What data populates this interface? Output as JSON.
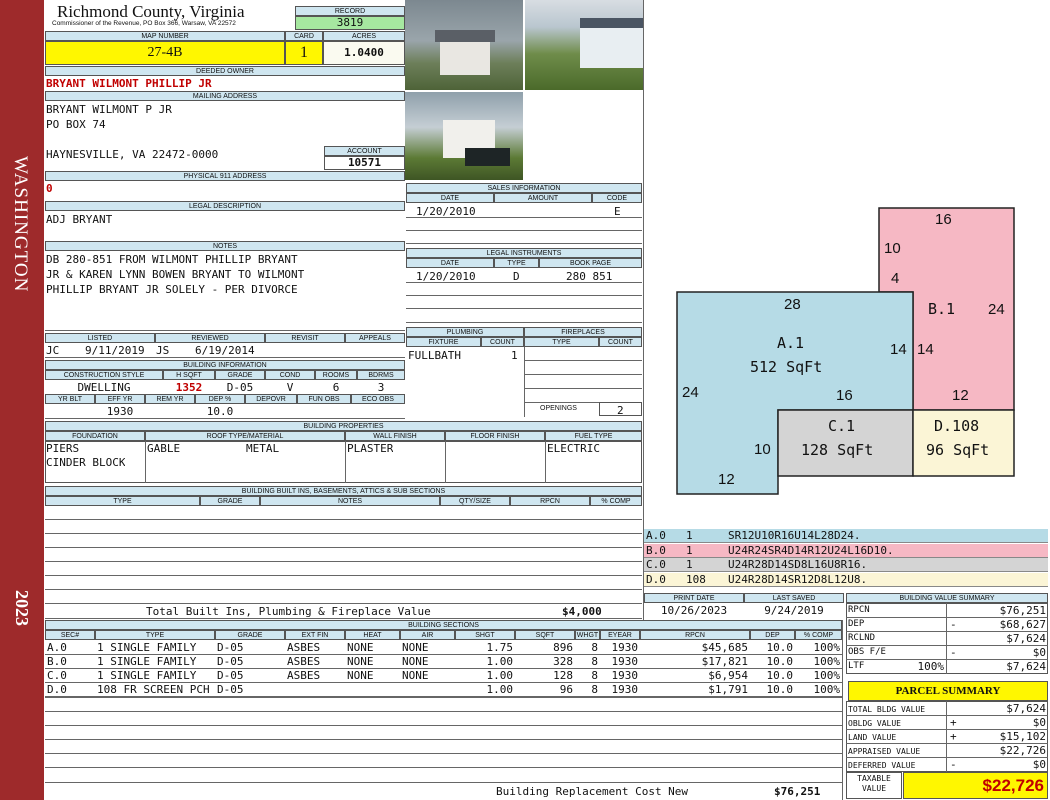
{
  "side": {
    "locality": "WASHINGTON",
    "year": "2023"
  },
  "header": {
    "county": "Richmond County, Virginia",
    "commissioner": "Commissioner of the Revenue, PO Box 366, Warsaw, VA 22572"
  },
  "record": {
    "label": "RECORD",
    "value": "3819"
  },
  "map": {
    "label": "MAP NUMBER",
    "value": "27-4B"
  },
  "card": {
    "label": "CARD",
    "value": "1"
  },
  "acres": {
    "label": "ACRES",
    "value": "1.0400"
  },
  "deeded_owner": {
    "label": "DEEDED OWNER",
    "value": "BRYANT WILMONT PHILLIP JR"
  },
  "mailing": {
    "label": "MAILING ADDRESS",
    "line1": "BRYANT WILMONT P JR",
    "line2": "PO BOX 74",
    "line3": "HAYNESVILLE, VA 22472-0000"
  },
  "account": {
    "label": "ACCOUNT",
    "value": "10571"
  },
  "physical": {
    "label": "PHYSICAL 911 ADDRESS",
    "value": "0"
  },
  "legal": {
    "label": "LEGAL DESCRIPTION",
    "value": "ADJ BRYANT"
  },
  "notes": {
    "label": "NOTES",
    "line1": "DB 280-851 FROM WILMONT PHILLIP BRYANT",
    "line2": "JR & KAREN LYNN BOWEN BRYANT TO WILMONT",
    "line3": "PHILLIP BRYANT JR SOLELY - PER DIVORCE"
  },
  "sales": {
    "label": "SALES INFORMATION",
    "date_h": "DATE",
    "amount_h": "AMOUNT",
    "code_h": "CODE",
    "date": "1/20/2010",
    "code": "E"
  },
  "instruments": {
    "label": "LEGAL INSTRUMENTS",
    "date_h": "DATE",
    "type_h": "TYPE",
    "book_h": "BOOK PAGE",
    "date": "1/20/2010",
    "type": "D",
    "book": "280 851"
  },
  "plumbing": {
    "label": "PLUMBING",
    "fixture_h": "FIXTURE",
    "count_h": "COUNT",
    "fixture": "FULLBATH",
    "count": "1"
  },
  "fireplaces": {
    "label": "FIREPLACES",
    "type_h": "TYPE",
    "count_h": "COUNT",
    "openings_h": "OPENINGS",
    "openings": "2"
  },
  "review": {
    "listed_h": "LISTED",
    "reviewed_h": "REVIEWED",
    "revisit_h": "REVISIT",
    "appeals_h": "APPEALS",
    "listed_by": "JC",
    "listed_date": "9/11/2019",
    "reviewed_by": "JS",
    "reviewed_date": "6/19/2014"
  },
  "bldg_info": {
    "label": "BUILDING INFORMATION",
    "style_h": "CONSTRUCTION STYLE",
    "hsqft_h": "H SQFT",
    "grade_h": "GRADE",
    "cond_h": "COND",
    "rooms_h": "ROOMS",
    "bdrms_h": "BDRMS",
    "style": "DWELLING",
    "hsqft": "1352",
    "grade": "D-05",
    "cond": "V",
    "rooms": "6",
    "bdrms": "3",
    "yrblt_h": "YR BLT",
    "effyr_h": "EFF YR",
    "remyr_h": "REM YR",
    "dep_h": "DEP %",
    "depovr_h": "DEPOVR",
    "funobs_h": "FUN OBS",
    "ecoobs_h": "ECO OBS",
    "effyr": "1930",
    "dep": "10.0"
  },
  "props": {
    "label": "BUILDING PROPERTIES",
    "foundation_h": "FOUNDATION",
    "roof_h": "ROOF TYPE/MATERIAL",
    "wall_h": "WALL FINISH",
    "floor_h": "FLOOR FINISH",
    "fuel_h": "FUEL TYPE",
    "foundation1": "PIERS",
    "foundation2": "CINDER BLOCK",
    "roof_type": "GABLE",
    "roof_mat": "METAL",
    "wall": "PLASTER",
    "fuel": "ELECTRIC"
  },
  "builtins": {
    "label": "BUILDING BUILT INS, BASEMENTS, ATTICS & SUB SECTIONS",
    "type_h": "TYPE",
    "grade_h": "GRADE",
    "notes_h": "NOTES",
    "qty_h": "QTY/SIZE",
    "rpcn_h": "RPCN",
    "pct_h": "% COMP",
    "total_label": "Total Built Ins, Plumbing & Fireplace Value",
    "total_value": "$4,000"
  },
  "sketch": {
    "a": {
      "name": "A.1",
      "area": "512 SqFt",
      "top": "28",
      "left": "24",
      "right": "14",
      "bottom": "16"
    },
    "b": {
      "name": "B.1",
      "top": "16",
      "left_top": "10",
      "left_bot": "4",
      "right": "24",
      "inner": "14",
      "bottom": "12"
    },
    "c": {
      "name": "C.1",
      "area": "128 SqFt",
      "left": "10",
      "bottom": "12"
    },
    "d": {
      "name": "D.108",
      "area": "96 SqFt"
    }
  },
  "vectors": [
    {
      "code": "A.0",
      "n": "1",
      "path": "SR12U10R16U14L28D24.",
      "color": "#b6dbe6"
    },
    {
      "code": "B.0",
      "n": "1",
      "path": "U24R24SR4D14R12U24L16D10.",
      "color": "#f6b8c4"
    },
    {
      "code": "C.0",
      "n": "1",
      "path": "U24R28D14SD8L16U8R16.",
      "color": "#d4d4d4"
    },
    {
      "code": "D.0",
      "n": "108",
      "path": "U24R28D14SR12D8L12U8.",
      "color": "#fbf5d6"
    }
  ],
  "dates": {
    "print_h": "PRINT DATE",
    "saved_h": "LAST SAVED",
    "print": "10/26/2023",
    "saved": "9/24/2019"
  },
  "sections": {
    "label": "BUILDING SECTIONS",
    "headers": [
      "SEC#",
      "TYPE",
      "GRADE",
      "EXT FIN",
      "HEAT",
      "AIR",
      "SHGT",
      "SQFT",
      "WHGT",
      "EYEAR",
      "RPCN",
      "DEP",
      "% COMP"
    ],
    "rows": [
      [
        "A.0",
        "1 SINGLE FAMILY",
        "D-05",
        "ASBES",
        "NONE",
        "NONE",
        "1.75",
        "896",
        "8",
        "1930",
        "$45,685",
        "10.0",
        "100%"
      ],
      [
        "B.0",
        "1 SINGLE FAMILY",
        "D-05",
        "ASBES",
        "NONE",
        "NONE",
        "1.00",
        "328",
        "8",
        "1930",
        "$17,821",
        "10.0",
        "100%"
      ],
      [
        "C.0",
        "1 SINGLE FAMILY",
        "D-05",
        "ASBES",
        "NONE",
        "NONE",
        "1.00",
        "128",
        "8",
        "1930",
        "$6,954",
        "10.0",
        "100%"
      ],
      [
        "D.0",
        "108 FR SCREEN PCH",
        "D-05",
        "",
        "",
        "",
        "1.00",
        "96",
        "8",
        "1930",
        "$1,791",
        "10.0",
        "100%"
      ]
    ],
    "replacement_label": "Building Replacement Cost New",
    "replacement_value": "$76,251"
  },
  "value_summary": {
    "label": "BUILDING VALUE SUMMARY",
    "rpcn_l": "RPCN",
    "rpcn": "$76,251",
    "dep_l": "DEP",
    "dep_sign": "-",
    "dep": "$68,627",
    "rclnd_l": "RCLND",
    "rclnd": "$7,624",
    "obs_l": "OBS F/E",
    "obs_sign": "-",
    "obs": "$0",
    "ltf_l": "LTF",
    "ltf_pct": "100%",
    "ltf": "$7,624"
  },
  "parcel": {
    "label": "PARCEL SUMMARY",
    "bldg_l": "TOTAL BLDG VALUE",
    "bldg": "$7,624",
    "obldg_l": "OBLDG VALUE",
    "obldg_sign": "+",
    "obldg": "$0",
    "land_l": "LAND VALUE",
    "land_sign": "+",
    "land": "$15,102",
    "appraised_l": "APPRAISED VALUE",
    "appraised": "$22,726",
    "deferred_l": "DEFERRED VALUE",
    "deferred_sign": "-",
    "deferred": "$0",
    "taxable_l1": "TAXABLE",
    "taxable_l2": "VALUE",
    "taxable": "$22,726"
  }
}
